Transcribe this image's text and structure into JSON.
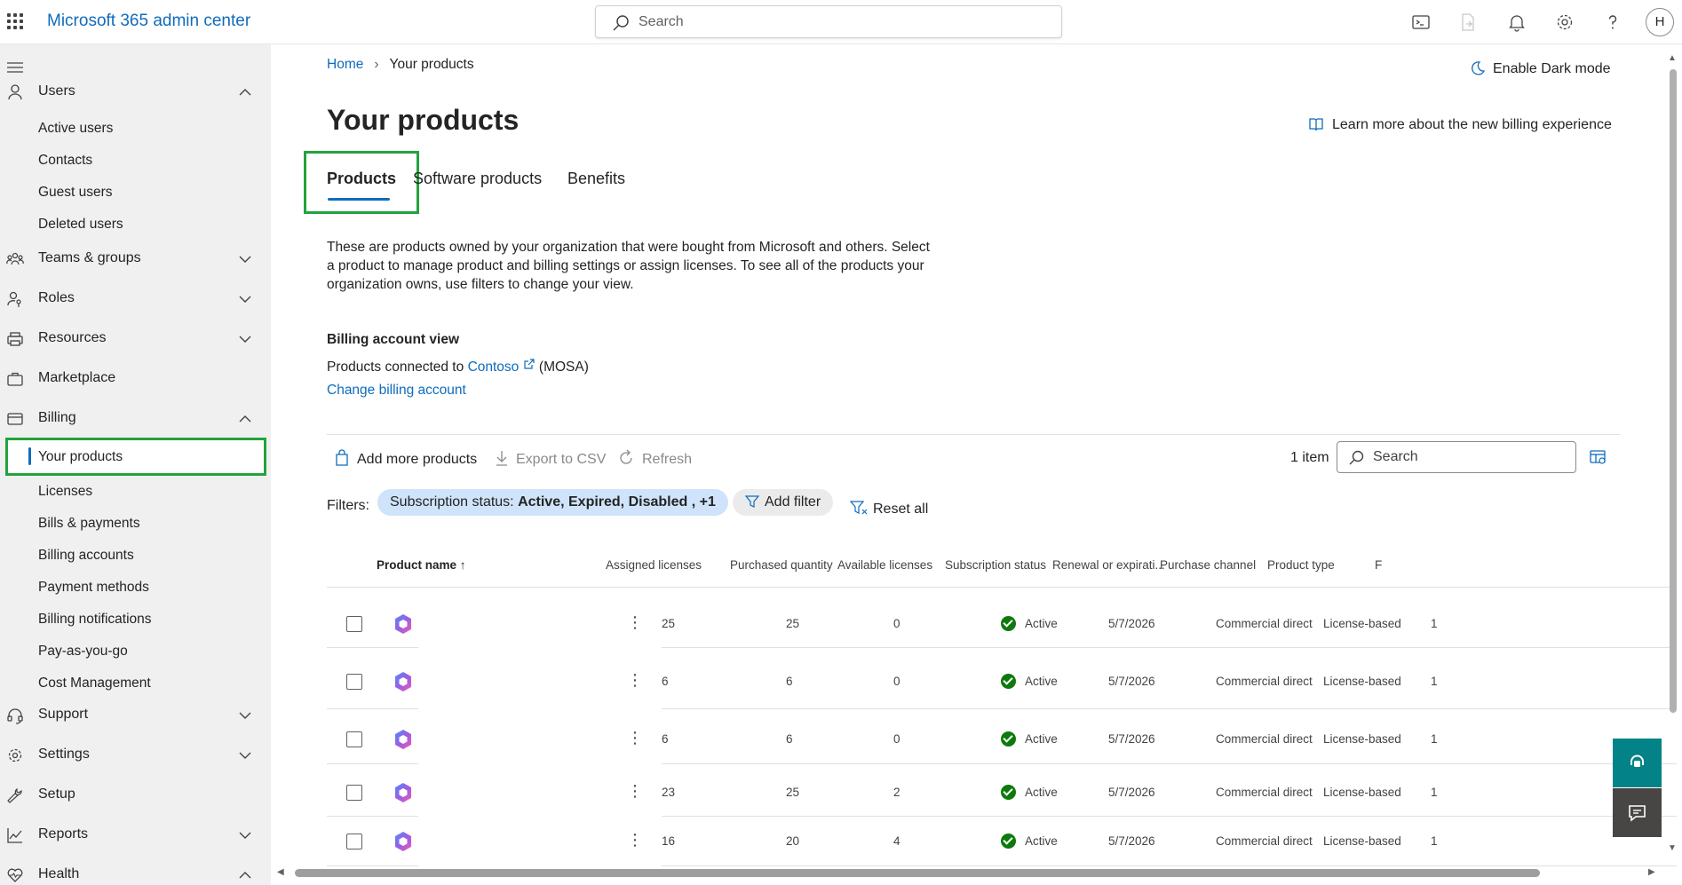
{
  "header": {
    "app_title": "Microsoft 365 admin center",
    "search_placeholder": "Search",
    "avatar_initial": "H"
  },
  "sidebar": {
    "sections": [
      {
        "label": "Users",
        "icon": "person-icon",
        "expanded": true,
        "children": [
          "Active users",
          "Contacts",
          "Guest users",
          "Deleted users"
        ]
      },
      {
        "label": "Teams & groups",
        "icon": "people-team-icon",
        "expanded": false
      },
      {
        "label": "Roles",
        "icon": "person-key-icon",
        "expanded": false
      },
      {
        "label": "Resources",
        "icon": "printer-icon",
        "expanded": false
      },
      {
        "label": "Marketplace",
        "icon": "briefcase-icon"
      },
      {
        "label": "Billing",
        "icon": "credit-card-icon",
        "expanded": true,
        "children": [
          "Your products",
          "Licenses",
          "Bills & payments",
          "Billing accounts",
          "Payment methods",
          "Billing notifications",
          "Pay-as-you-go",
          "Cost Management"
        ]
      },
      {
        "label": "Support",
        "icon": "headset-icon",
        "expanded": false
      },
      {
        "label": "Settings",
        "icon": "gear-icon",
        "expanded": false
      },
      {
        "label": "Setup",
        "icon": "wrench-icon"
      },
      {
        "label": "Reports",
        "icon": "chart-line-icon",
        "expanded": false
      },
      {
        "label": "Health",
        "icon": "heart-pulse-icon",
        "expanded": true
      }
    ],
    "selected": "Your products"
  },
  "breadcrumb": {
    "home": "Home",
    "current": "Your products"
  },
  "dark_mode_label": "Enable Dark mode",
  "page_title": "Your products",
  "learn_more": "Learn more about the new billing experience",
  "tabs": [
    "Products",
    "Software products",
    "Benefits"
  ],
  "active_tab": "Products",
  "description": "These are products owned by your organization that were bought from Microsoft and others. Select a product to manage product and billing settings or assign licenses. To see all of the products your organization owns, use filters to change your view.",
  "billing_view": {
    "title": "Billing account view",
    "connected_prefix": "Products connected to",
    "account_name": "Contoso",
    "account_suffix": "(MOSA)",
    "change_link": "Change billing account"
  },
  "commands": {
    "add_more": "Add more products",
    "export": "Export to CSV",
    "refresh": "Refresh",
    "item_count": "1 item",
    "search_placeholder": "Search"
  },
  "filters": {
    "label": "Filters:",
    "status_prefix": "Subscription status:",
    "status_values": "Active, Expired, Disabled , +1",
    "add_filter": "Add filter",
    "reset": "Reset all"
  },
  "table": {
    "columns": [
      "Product name",
      "Assigned licenses",
      "Purchased quantity",
      "Available licenses",
      "Subscription status",
      "Renewal or expirati...",
      "Purchase channel",
      "Product type",
      "F"
    ],
    "rows": [
      {
        "assigned": "25",
        "purchased": "25",
        "available": "0",
        "status": "Active",
        "renewal": "5/7/2026",
        "channel": "Commercial direct",
        "type": "License-based",
        "extra": "1"
      },
      {
        "assigned": "6",
        "purchased": "6",
        "available": "0",
        "status": "Active",
        "renewal": "5/7/2026",
        "channel": "Commercial direct",
        "type": "License-based",
        "extra": "1"
      },
      {
        "assigned": "6",
        "purchased": "6",
        "available": "0",
        "status": "Active",
        "renewal": "5/7/2026",
        "channel": "Commercial direct",
        "type": "License-based",
        "extra": "1"
      },
      {
        "assigned": "23",
        "purchased": "25",
        "available": "2",
        "status": "Active",
        "renewal": "5/7/2026",
        "channel": "Commercial direct",
        "type": "License-based",
        "extra": "1"
      },
      {
        "assigned": "16",
        "purchased": "20",
        "available": "4",
        "status": "Active",
        "renewal": "5/7/2026",
        "channel": "Commercial direct",
        "type": "License-based",
        "extra": "1"
      }
    ]
  },
  "colors": {
    "accent": "#0f6cbd",
    "highlight_box": "#23a33c",
    "status_active": "#0e7a0d",
    "filter_pill": "#cfe4fa",
    "help_button": "#038387"
  }
}
